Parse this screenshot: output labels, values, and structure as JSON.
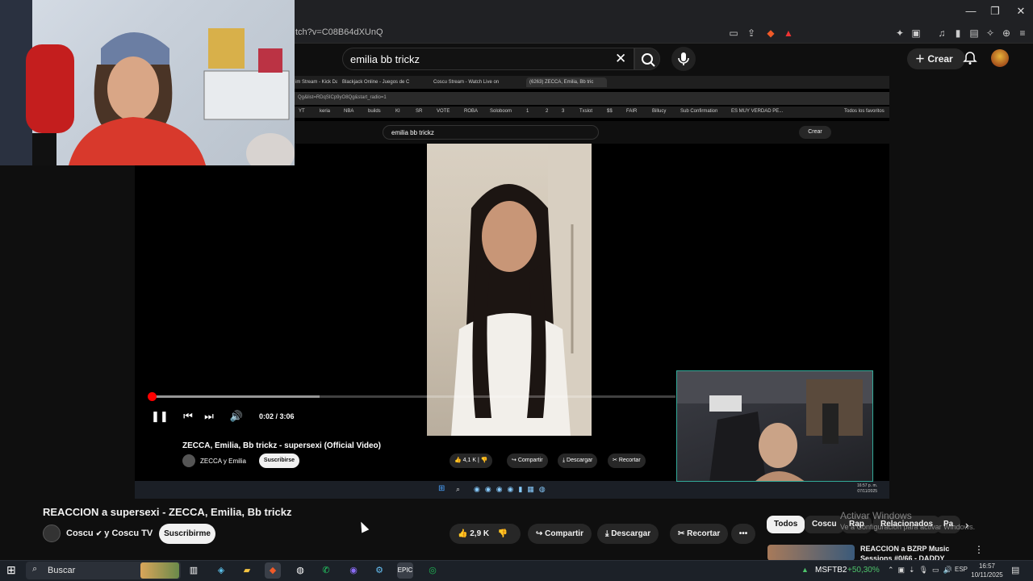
{
  "browser": {
    "url_fragment": "tch?v=C08B64dXUnQ",
    "window_controls": [
      "—",
      "❐",
      "✕"
    ]
  },
  "youtube": {
    "search_query": "emilia bb trickz",
    "create_label": "Crear"
  },
  "inner_browser": {
    "tabs": [
      "im Stream - Kick Da",
      "Blackjack Online - Juegos de C",
      "Coscu Stream - Watch Live on",
      "(6263) ZECCA, Emilia, Bb tric"
    ],
    "url": "Qg&list=RDqSICp9yO8Qg&start_radio=1",
    "bookmarks": [
      "YT",
      "keria",
      "NBA",
      "builds",
      "KI",
      "SR",
      "VOTE",
      "ROBA",
      "Soloboom",
      "1",
      "2",
      "3",
      "Txslot",
      "$$",
      "FAIR",
      "Billucy",
      "Sub Confirmation",
      "ES MUY VERDAD PE...",
      "Todos los favoritos"
    ],
    "search_query": "emilia bb trickz",
    "create_label": "Crear",
    "time": "0:02 / 3:06",
    "video_title": "ZECCA, Emilia, Bb trickz - supersexi (Official Video)",
    "channel": "ZECCA y Emilia",
    "subscribe": "Suscribirse",
    "likes": "4,1 K",
    "share": "Compartir",
    "download": "Descargar",
    "clip": "Recortar",
    "clock_time": "16:57 p. m.",
    "clock_date": "07/11/2025",
    "progress_fraction": 0.011
  },
  "main": {
    "title": "REACCION a supersexi - ZECCA, Emilia, Bb trickz",
    "channel": "Coscu",
    "channel_suffix": "y Coscu TV",
    "subscribe": "Suscribirme",
    "likes": "2,9 K",
    "share": "Compartir",
    "download": "Descargar",
    "clip": "Recortar",
    "more": "•••"
  },
  "chips": [
    "Todos",
    "Coscu",
    "Rap",
    "Relacionados",
    "Pa"
  ],
  "watermark": {
    "line1": "Activar Windows",
    "line2": "Ve a Configuración para activar Windows."
  },
  "related": {
    "title": "REACCION a BZRP Music Sessions #0/66 - DADDY"
  },
  "taskbar": {
    "search_placeholder": "Buscar",
    "ticker_symbol": "MSFTB2",
    "ticker_change": "+50,30%",
    "language": "ESP",
    "time": "16:57",
    "date": "10/11/2025"
  },
  "colors": {
    "accent": "#ff0000",
    "background": "#0f0f0f",
    "taskbar": "#1c2128",
    "ticker_positive": "#4ec46b"
  }
}
